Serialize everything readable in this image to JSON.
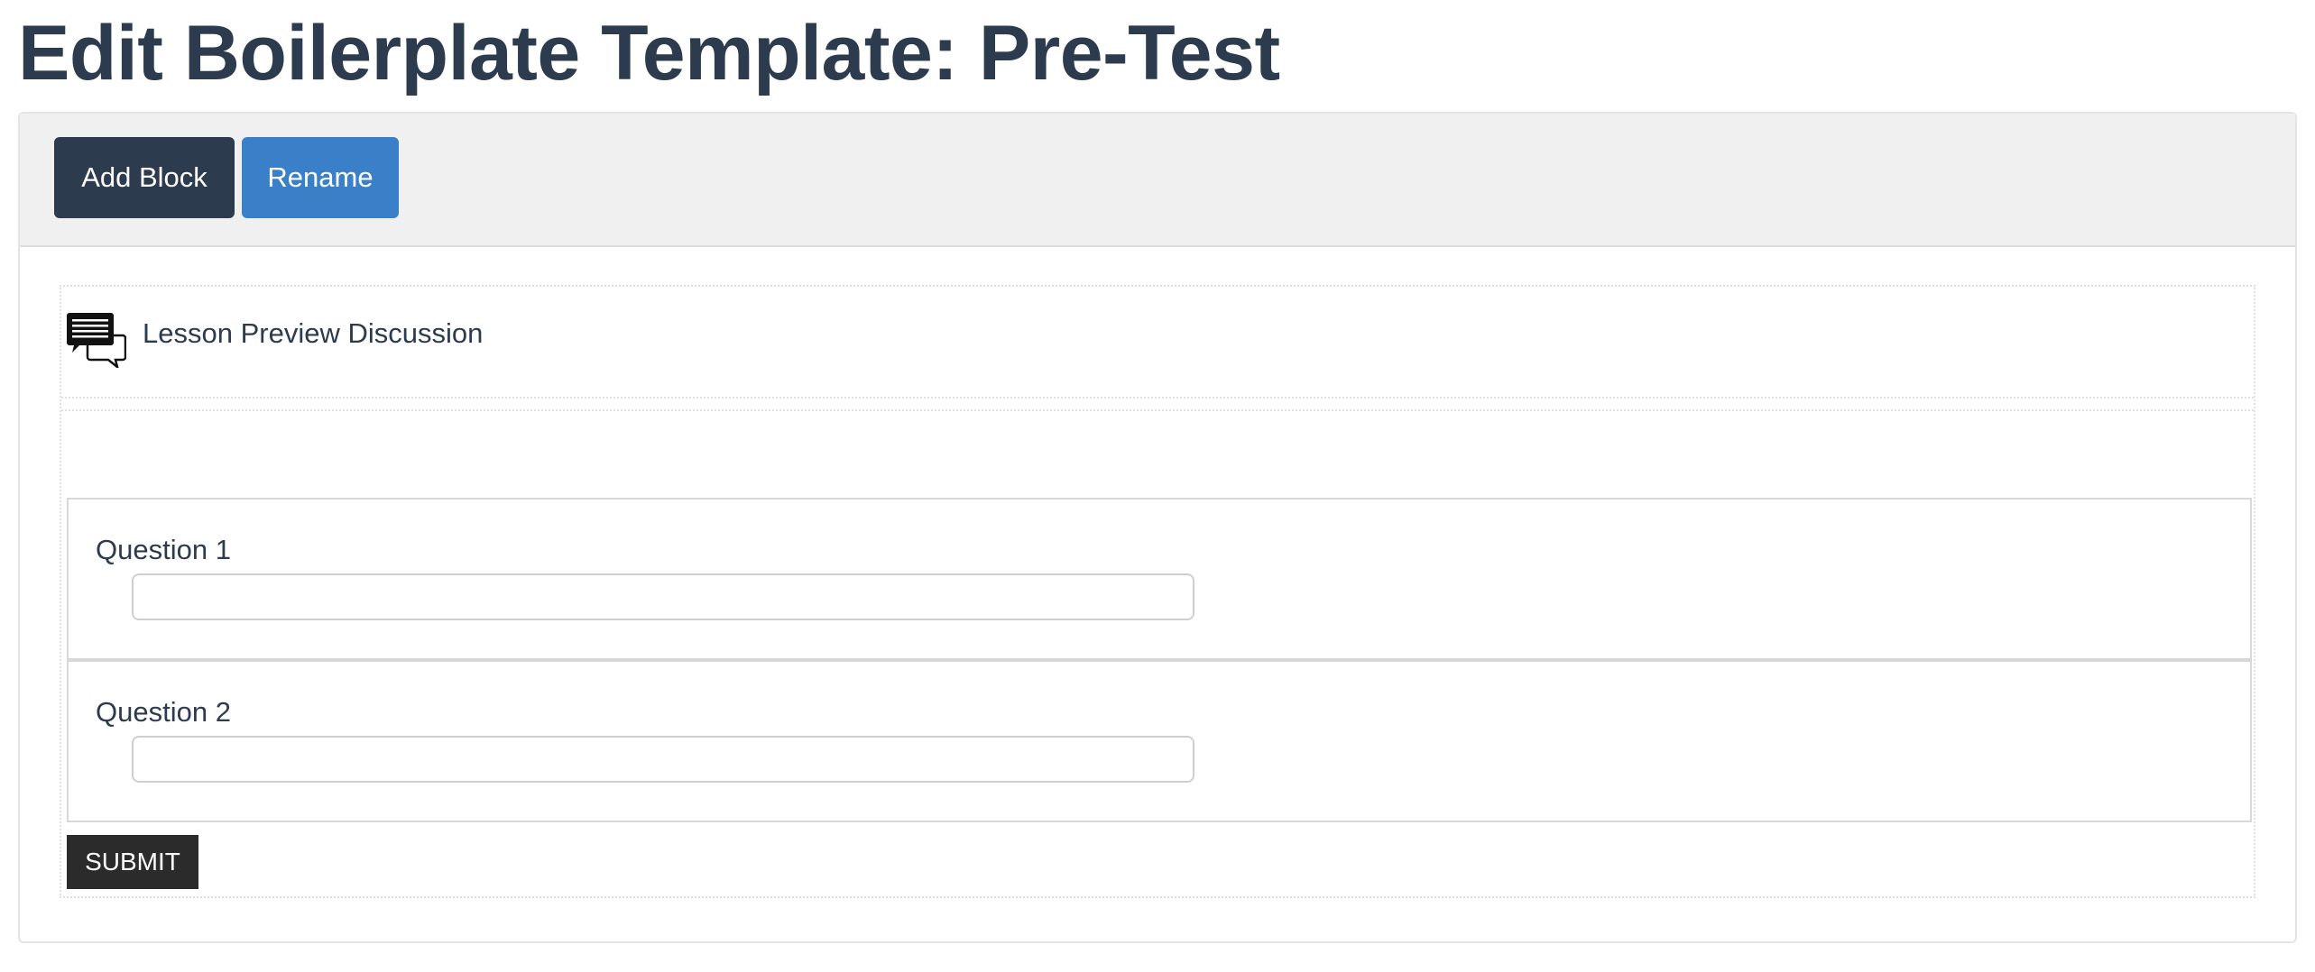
{
  "page": {
    "title": "Edit Boilerplate Template: Pre-Test"
  },
  "toolbar": {
    "add_block_label": "Add Block",
    "rename_label": "Rename"
  },
  "discussion": {
    "icon": "discussion-icon",
    "label": "Lesson Preview Discussion"
  },
  "questions": [
    {
      "label": "Question 1",
      "value": ""
    },
    {
      "label": "Question 2",
      "value": ""
    }
  ],
  "submit_label": "SUBMIT",
  "colors": {
    "title": "#2d3b4e",
    "add_block_button": "#2d3b4e",
    "rename_button": "#3a80c8",
    "submit_button": "#2b2b2b",
    "toolbar_bg": "#f0f0f0"
  }
}
